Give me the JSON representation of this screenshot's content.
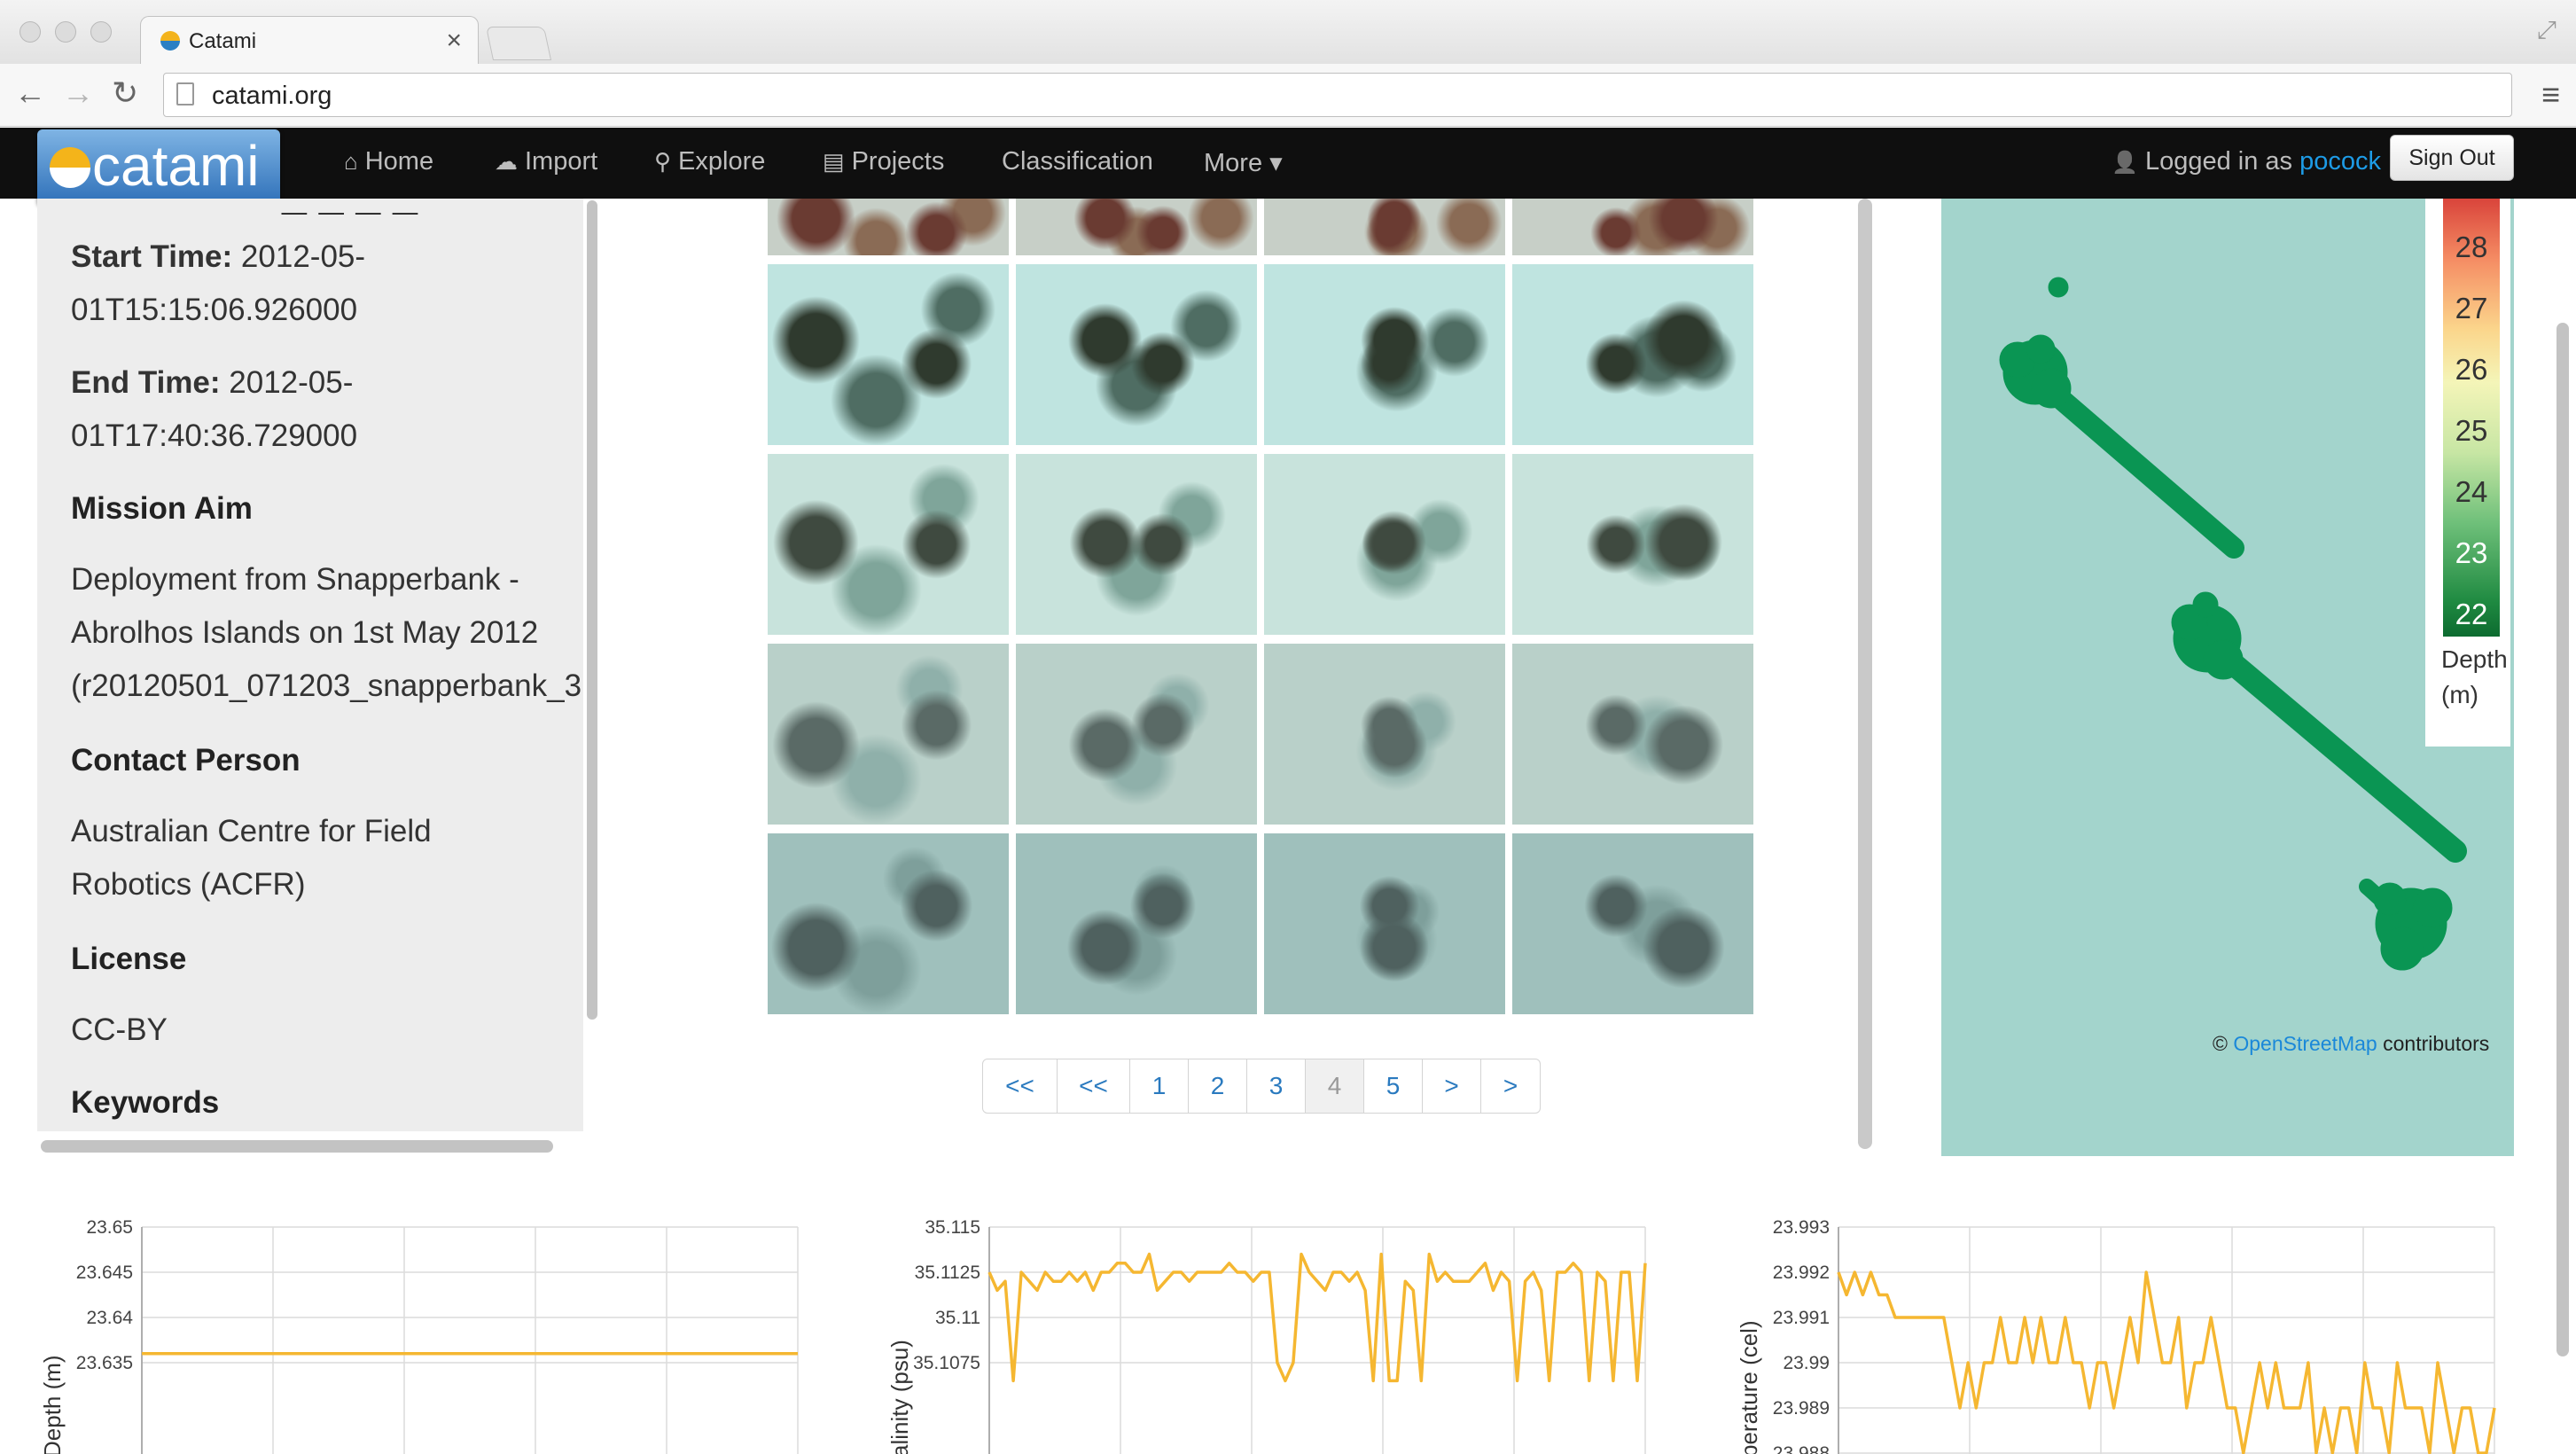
{
  "browser": {
    "tab_title": "Catami",
    "url": "catami.org",
    "tab_close": "×",
    "back": "←",
    "forward": "→",
    "reload": "↻",
    "menu": "≡",
    "resize": "⤢"
  },
  "navbar": {
    "logo": "catami",
    "links": [
      {
        "label": "Home",
        "icon": "home-icon",
        "glyph": "⌂"
      },
      {
        "label": "Import",
        "icon": "cloud-icon",
        "glyph": "☁"
      },
      {
        "label": "Explore",
        "icon": "search-icon",
        "glyph": "⚲"
      },
      {
        "label": "Projects",
        "icon": "list-icon",
        "glyph": "▤"
      },
      {
        "label": "Classification",
        "icon": "",
        "glyph": ""
      },
      {
        "label": "More",
        "icon": "caret-down-icon",
        "glyph": "▾"
      }
    ],
    "logged_in_prefix": "Logged in as",
    "username": "pocock",
    "user_glyph": "👤",
    "sign_out": "Sign Out"
  },
  "info": {
    "cut_heading": "_ _ _ _",
    "start_time_label": "Start Time:",
    "start_time_value_1": "2012-05-",
    "start_time_value_2": "01T15:15:06.926000",
    "end_time_label": "End Time:",
    "end_time_value_1": "2012-05-",
    "end_time_value_2": "01T17:40:36.729000",
    "mission_aim_heading": "Mission Aim",
    "mission_aim_lines": [
      "Deployment from Snapperbank -",
      "Abrolhos Islands on 1st May 2012",
      "(r20120501_071203_snapperbank_3"
    ],
    "contact_heading": "Contact Person",
    "contact_lines": [
      "Australian Centre for Field",
      "Robotics (ACFR)"
    ],
    "license_heading": "License",
    "license_value": "CC-BY",
    "keywords_heading": "Keywords"
  },
  "pagination": [
    "<<",
    "<<",
    "1",
    "2",
    "3",
    "4",
    "5",
    ">",
    ">"
  ],
  "pagination_active": "4",
  "map": {
    "legend_ticks": [
      "28",
      "27",
      "26",
      "25",
      "24",
      "23",
      "22"
    ],
    "legend_title_1": "Depth",
    "legend_title_2": "(m)",
    "attribution_prefix": "©",
    "attribution_link": "OpenStreetMap",
    "attribution_suffix": "contributors"
  },
  "colors": {
    "navbar_bg": "#0f0f0f",
    "link": "#1d9be6",
    "map_water": "#a3d4cc",
    "track": "#0a9553",
    "chart_line": "#f5b731"
  },
  "chart_data": [
    {
      "type": "line",
      "ylabel": "Depth (m)",
      "yticks": [
        "23.65",
        "23.645",
        "23.64",
        "23.635"
      ],
      "ylim": [
        23.633,
        23.65
      ],
      "grid": true,
      "values": [
        23.636,
        23.636,
        23.636,
        23.636,
        23.636,
        23.636,
        23.636,
        23.636,
        23.636,
        23.636
      ]
    },
    {
      "type": "line",
      "ylabel": "alinity (psu)",
      "yticks": [
        "35.115",
        "35.1125",
        "35.11",
        "35.1075"
      ],
      "ylim": [
        35.1065,
        35.115
      ],
      "grid": true,
      "values": [
        35.1125,
        35.1115,
        35.112,
        35.1065,
        35.1125,
        35.112,
        35.1115,
        35.1125,
        35.112,
        35.112,
        35.1125,
        35.112,
        35.1125,
        35.1115,
        35.1125,
        35.1125,
        35.113,
        35.113,
        35.1125,
        35.1125,
        35.1135,
        35.1115,
        35.112,
        35.1125,
        35.1125,
        35.112,
        35.1125,
        35.1125,
        35.1125,
        35.1125,
        35.113,
        35.1125,
        35.1125,
        35.112,
        35.1125,
        35.1125,
        35.1075,
        35.1065,
        35.1075,
        35.1135,
        35.1125,
        35.112,
        35.1115,
        35.1125,
        35.1125,
        35.112,
        35.1125,
        35.1115,
        35.1065,
        35.1135,
        35.1065,
        35.1065,
        35.112,
        35.1115,
        35.1065,
        35.1135,
        35.112,
        35.1125,
        35.112,
        35.112,
        35.112,
        35.1125,
        35.113,
        35.1115,
        35.1125,
        35.112,
        35.1065,
        35.112,
        35.1125,
        35.1115,
        35.1065,
        35.1125,
        35.1125,
        35.113,
        35.1125,
        35.1065,
        35.1125,
        35.112,
        35.1065,
        35.1125,
        35.1125,
        35.1065,
        35.113
      ]
    },
    {
      "type": "line",
      "ylabel": "perature (cel)",
      "yticks": [
        "23.993",
        "23.992",
        "23.991",
        "23.99",
        "23.989",
        "23.988"
      ],
      "ylim": [
        23.988,
        23.993
      ],
      "grid": true,
      "values": [
        23.992,
        23.9915,
        23.992,
        23.9915,
        23.992,
        23.9915,
        23.9915,
        23.991,
        23.991,
        23.991,
        23.991,
        23.991,
        23.991,
        23.991,
        23.99,
        23.989,
        23.99,
        23.989,
        23.99,
        23.99,
        23.991,
        23.99,
        23.99,
        23.991,
        23.99,
        23.991,
        23.99,
        23.99,
        23.991,
        23.99,
        23.99,
        23.989,
        23.99,
        23.99,
        23.989,
        23.99,
        23.991,
        23.99,
        23.992,
        23.991,
        23.99,
        23.99,
        23.991,
        23.989,
        23.99,
        23.99,
        23.991,
        23.99,
        23.989,
        23.989,
        23.988,
        23.989,
        23.99,
        23.989,
        23.99,
        23.989,
        23.989,
        23.989,
        23.99,
        23.988,
        23.989,
        23.988,
        23.989,
        23.989,
        23.988,
        23.99,
        23.989,
        23.989,
        23.988,
        23.99,
        23.989,
        23.989,
        23.989,
        23.988,
        23.99,
        23.989,
        23.988,
        23.989,
        23.989,
        23.988,
        23.988,
        23.989
      ]
    }
  ]
}
